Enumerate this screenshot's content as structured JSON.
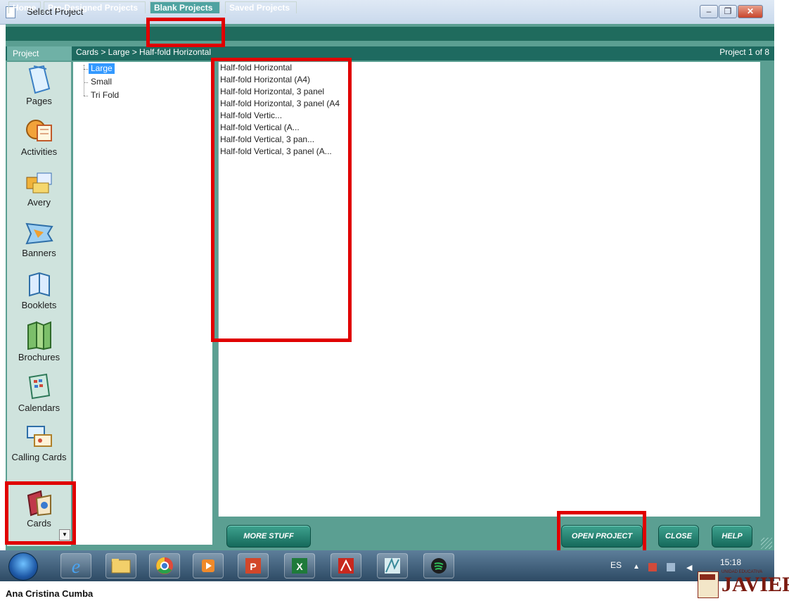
{
  "window": {
    "title": "Select Project",
    "controls": [
      "minimize-icon",
      "restore-icon",
      "close-icon"
    ]
  },
  "tabs": [
    {
      "label": "Home",
      "active": false
    },
    {
      "label": "Pre-Designed Projects",
      "active": false
    },
    {
      "label": "Blank Projects",
      "active": true
    },
    {
      "label": "Saved Projects",
      "active": false
    }
  ],
  "header": {
    "project_label": "Project",
    "breadcrumb": "Cards > Large > Half-fold Horizontal",
    "counter": "Project 1 of 8"
  },
  "sidebar": {
    "items": [
      {
        "label": "Pages",
        "icon": "pages-icon"
      },
      {
        "label": "Activities",
        "icon": "activities-icon"
      },
      {
        "label": "Avery",
        "icon": "avery-icon"
      },
      {
        "label": "Banners",
        "icon": "banners-icon"
      },
      {
        "label": "Booklets",
        "icon": "booklets-icon"
      },
      {
        "label": "Brochures",
        "icon": "brochures-icon"
      },
      {
        "label": "Calendars",
        "icon": "calendars-icon"
      },
      {
        "label": "Calling Cards",
        "icon": "calling-cards-icon"
      },
      {
        "label": "Cards",
        "icon": "cards-icon",
        "selected": true
      }
    ]
  },
  "tree": {
    "items": [
      {
        "label": "Large",
        "selected": true
      },
      {
        "label": "Small",
        "selected": false
      },
      {
        "label": "Tri Fold",
        "selected": false
      }
    ]
  },
  "projects": {
    "items": [
      "Half-fold Horizontal",
      "Half-fold Horizontal (A4)",
      "Half-fold Horizontal, 3 panel",
      "Half-fold Horizontal, 3 panel (A4",
      "Half-fold Vertic...",
      "Half-fold Vertical (A...",
      "Half-fold Vertical, 3 pan...",
      "Half-fold Vertical, 3 panel (A..."
    ]
  },
  "buttons": {
    "more_stuff": "MORE STUFF",
    "open_project": "OPEN PROJECT",
    "close": "CLOSE",
    "help": "HELP"
  },
  "taskbar": {
    "apps": [
      "internet-explorer-icon",
      "file-explorer-icon",
      "chrome-icon",
      "media-player-icon",
      "powerpoint-icon",
      "excel-icon",
      "acrobat-icon",
      "app-icon",
      "spotify-icon"
    ],
    "language": "ES",
    "clock": "15:18"
  },
  "footer": {
    "author": "Ana Cristina Cumba",
    "logo_text": "JAVIER",
    "logo_small": "UNIDAD EDUCATIVA"
  },
  "colors": {
    "frame": "#5b9f92",
    "tab_bar": "#1f6b5d",
    "highlight": "#e00000",
    "selection": "#3399ff"
  }
}
